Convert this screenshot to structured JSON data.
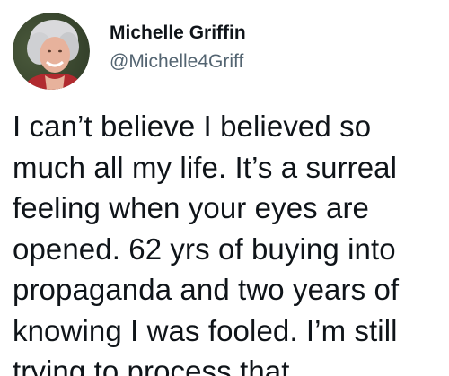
{
  "author": {
    "display_name": "Michelle Griffin",
    "handle": "@Michelle4Griff",
    "avatar_icon": "profile-photo"
  },
  "tweet": {
    "text": "I can’t believe I believed so\nmuch all my life. It’s a surreal\nfeeling when your eyes are\nopened. 62 yrs of buying into\npropaganda and two years of\nknowing I was fooled. I’m still\ntrying to process that."
  },
  "colors": {
    "text_primary": "#0f1419",
    "text_secondary": "#536471",
    "background": "#ffffff"
  }
}
